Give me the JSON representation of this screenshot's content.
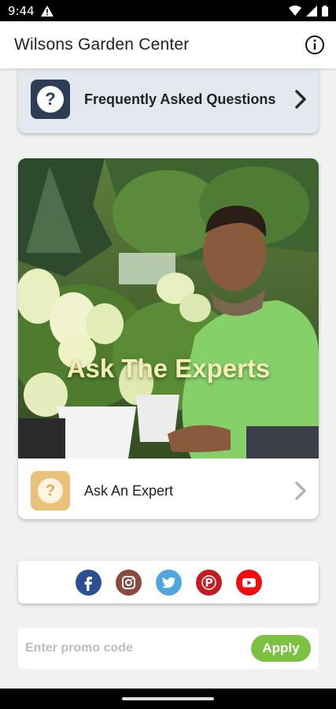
{
  "status_bar": {
    "time": "9:44"
  },
  "app_bar": {
    "title": "Wilsons Garden Center",
    "info_icon": "info-icon"
  },
  "faq": {
    "label": "Frequently Asked Questions",
    "badge_glyph": "?",
    "badge_color": "#2e3d53"
  },
  "expert": {
    "hero_text": "Ask The Experts",
    "label": "Ask An Expert",
    "badge_glyph": "?",
    "badge_color": "#e9c17b"
  },
  "social": [
    {
      "name": "facebook",
      "glyph": "f",
      "color": "#2c4f91"
    },
    {
      "name": "instagram",
      "color": "#8b4a3c"
    },
    {
      "name": "twitter",
      "color": "#50a7e0"
    },
    {
      "name": "pinterest",
      "glyph": "P",
      "color": "#c51c23"
    },
    {
      "name": "youtube",
      "color": "#f00d0d"
    }
  ],
  "promo": {
    "placeholder": "Enter promo code",
    "apply_label": "Apply",
    "apply_color": "#7bc242"
  }
}
